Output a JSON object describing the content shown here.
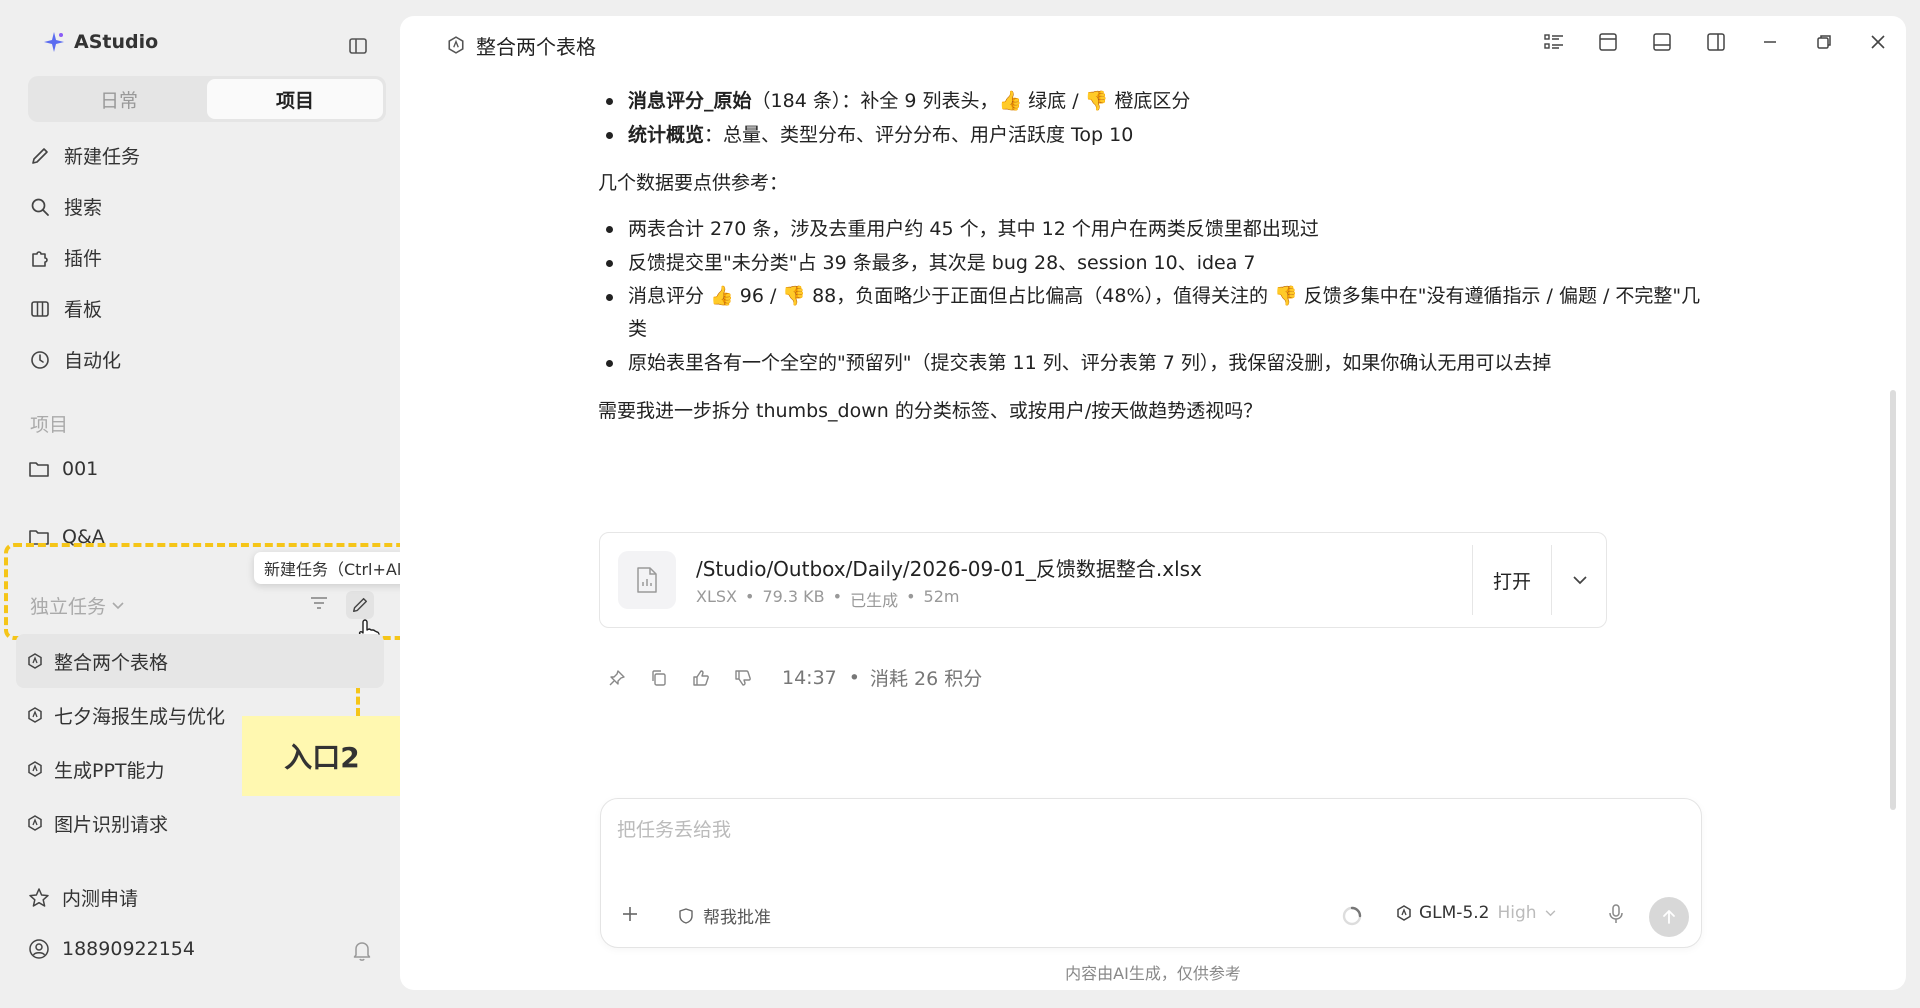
{
  "app": {
    "name": "AStudio"
  },
  "segment": {
    "daily": "日常",
    "project": "项目"
  },
  "nav": [
    {
      "label": "新建任务",
      "icon": "pencil-icon"
    },
    {
      "label": "搜索",
      "icon": "search-icon"
    },
    {
      "label": "插件",
      "icon": "plugin-icon"
    },
    {
      "label": "看板",
      "icon": "board-icon"
    },
    {
      "label": "自动化",
      "icon": "clock-icon"
    }
  ],
  "projects": {
    "label": "项目",
    "items": [
      "001",
      "Q&A"
    ]
  },
  "independent": {
    "label": "独立任务",
    "tooltip": "新建任务（Ctrl+Alt+N）",
    "callout": "入口2",
    "tasks": [
      "整合两个表格",
      "七夕海报生成与优化",
      "生成PPT能力",
      "图片识别请求"
    ]
  },
  "bottom": {
    "beta": "内测申请",
    "user": "18890922154"
  },
  "header": {
    "title": "整合两个表格"
  },
  "chat": {
    "bullets1": [
      {
        "bold": "消息评分_原始",
        "text": "（184 条）：补全 9 列表头，👍 绿底 / 👎 橙底区分"
      },
      {
        "bold": "统计概览",
        "text": "：总量、类型分布、评分分布、用户活跃度 Top 10"
      }
    ],
    "intro": "几个数据要点供参考：",
    "bullets2": [
      "两表合计 270 条，涉及去重用户约 45 个，其中 12 个用户在两类反馈里都出现过",
      "反馈提交里\"未分类\"占 39 条最多，其次是 bug 28、session 10、idea 7",
      "消息评分 👍 96 / 👎 88，负面略少于正面但占比偏高（48%），值得关注的 👎 反馈多集中在\"没有遵循指示 / 偏题 / 不完整\"几类",
      "原始表里各有一个全空的\"预留列\"（提交表第 11 列、评分表第 7 列），我保留没删，如果你确认无用可以去掉"
    ],
    "question": "需要我进一步拆分 thumbs_down 的分类标签、或按用户/按天做趋势透视吗？"
  },
  "file": {
    "path": "/Studio/Outbox/Daily/2026-09-01_反馈数据整合.xlsx",
    "type": "XLSX",
    "size": "79.3 KB",
    "status": "已生成",
    "age": "52m",
    "open": "打开"
  },
  "message_meta": {
    "time": "14:37",
    "cost": "消耗 26 积分"
  },
  "composer": {
    "placeholder": "把任务丢给我",
    "review": "帮我批准",
    "model": "GLM-5.2",
    "level": "High"
  },
  "disclaimer": "内容由AI生成，仅供参考"
}
